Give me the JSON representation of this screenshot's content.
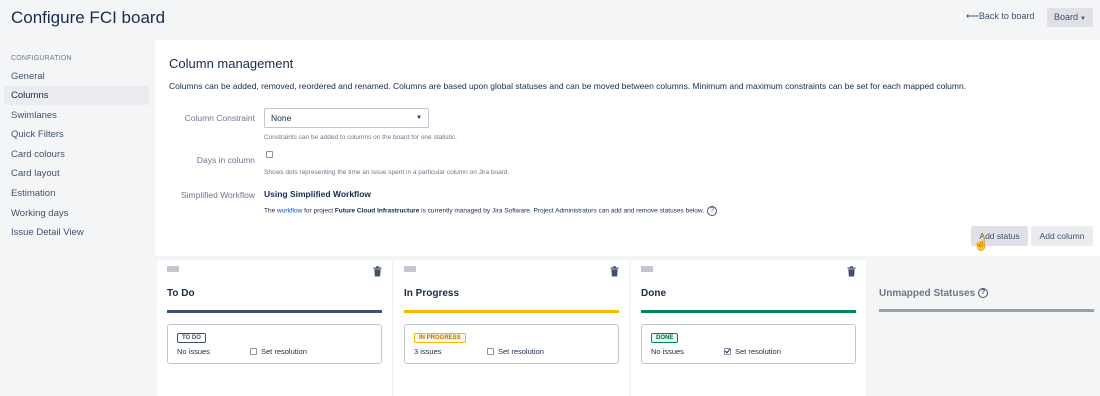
{
  "header": {
    "title": "Configure FCI board",
    "back_link": "Back to board",
    "board_button": "Board"
  },
  "sidebar": {
    "heading": "CONFIGURATION",
    "items": [
      {
        "label": "General"
      },
      {
        "label": "Columns",
        "active": true
      },
      {
        "label": "Swimlanes"
      },
      {
        "label": "Quick Filters"
      },
      {
        "label": "Card colours"
      },
      {
        "label": "Card layout"
      },
      {
        "label": "Estimation"
      },
      {
        "label": "Working days"
      },
      {
        "label": "Issue Detail View"
      }
    ]
  },
  "main": {
    "title": "Column management",
    "description": "Columns can be added, removed, reordered and renamed. Columns are based upon global statuses and can be moved between columns. Minimum and maximum constraints can be set for each mapped column.",
    "constraint": {
      "label": "Column Constraint",
      "value": "None",
      "hint": "Constraints can be added to columns on the board for one statistic."
    },
    "days_in_column": {
      "label": "Days in column",
      "checked": false,
      "hint": "Shows dots representing the time an issue spent in a particular column on Jira board."
    },
    "workflow": {
      "label": "Simplified Workflow",
      "title": "Using Simplified Workflow",
      "desc_prefix": "The ",
      "desc_link": "workflow",
      "desc_mid": " for project ",
      "desc_project": "Future Cloud Infrastructure",
      "desc_suffix": " is currently managed by Jira Software. Project Administrators can add and remove statuses below."
    },
    "add_status_label": "Add status",
    "add_column_label": "Add column"
  },
  "columns": [
    {
      "title": "To Do",
      "bar_color": "#42526e",
      "status": "TO DO",
      "status_color": "#42526e",
      "issues": "No issues",
      "set_resolution": "Set resolution",
      "resolution_checked": false
    },
    {
      "title": "In Progress",
      "bar_color": "#f6b800",
      "status": "IN PROGRESS",
      "status_color": "#b86e00",
      "issues": "3 issues",
      "set_resolution": "Set resolution",
      "resolution_checked": false
    },
    {
      "title": "Done",
      "bar_color": "#00875a",
      "status": "DONE",
      "status_color": "#006644",
      "issues": "No issues",
      "set_resolution": "Set resolution",
      "resolution_checked": true
    }
  ],
  "unmapped": {
    "title": "Unmapped Statuses"
  }
}
